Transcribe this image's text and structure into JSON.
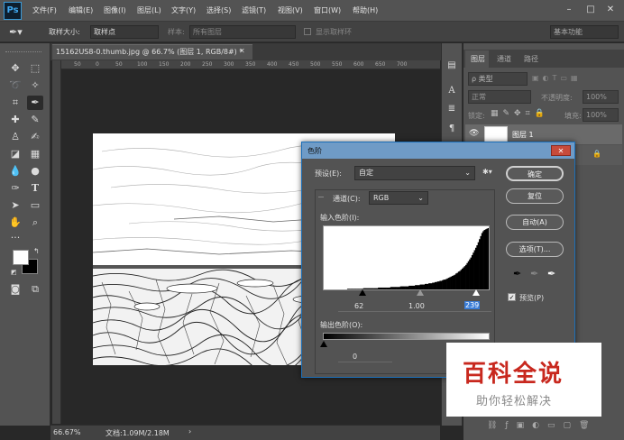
{
  "app": {
    "logo": "Ps"
  },
  "menu": [
    "文件(F)",
    "编辑(E)",
    "图像(I)",
    "图层(L)",
    "文字(Y)",
    "选择(S)",
    "滤镜(T)",
    "视图(V)",
    "窗口(W)",
    "帮助(H)"
  ],
  "window": {
    "minimize": "–",
    "maximize": "□",
    "close": "✕"
  },
  "options": {
    "sample_size_label": "取样大小:",
    "sample_size_value": "取样点",
    "sample_label": "样本:",
    "sample_value": "所有图层",
    "show_ring": "显示取样环",
    "workspace": "基本功能"
  },
  "document": {
    "tab": "15162US8-0.thumb.jpg @ 66.7% (图层 1, RGB/8#) *",
    "tab_close": "✕",
    "zoom": "66.67%",
    "doc_size": "文档:1.09M/2.18M"
  },
  "ruler": [
    "50",
    "0",
    "50",
    "100",
    "150",
    "200",
    "250",
    "300",
    "350",
    "400",
    "450",
    "500",
    "550",
    "600",
    "650",
    "700"
  ],
  "layers": {
    "tabs": [
      "图层",
      "通道",
      "路径"
    ],
    "search": "ρ 类型",
    "blend": "正常",
    "opacity_label": "不透明度:",
    "opacity": "100%",
    "lock_label": "锁定:",
    "fill_label": "填充:",
    "fill": "100%",
    "layer_name": "图层 1"
  },
  "dialog": {
    "title": "色阶",
    "preset_label": "预设(E):",
    "preset_value": "自定",
    "channel_label": "通道(C):",
    "channel_value": "RGB",
    "input_label": "输入色阶(I):",
    "input_black": "62",
    "input_gamma": "1.00",
    "input_white": "239",
    "output_label": "输出色阶(O):",
    "output_black": "0",
    "ok": "确定",
    "reset": "复位",
    "auto": "自动(A)",
    "options": "选项(T)...",
    "preview": "预览(P)"
  },
  "watermark": {
    "title": "百科全说",
    "subtitle": "助你轻松解决"
  },
  "histogram": {
    "bins": [
      0,
      0,
      0,
      0,
      0,
      0,
      0,
      0,
      0,
      0,
      0,
      0,
      0,
      0,
      0,
      0,
      0,
      0,
      0,
      1,
      1,
      1,
      1,
      1,
      1,
      1,
      1,
      1,
      1,
      1,
      1,
      1,
      2,
      2,
      2,
      2,
      2,
      2,
      2,
      2,
      2,
      2,
      2,
      2,
      3,
      3,
      3,
      3,
      3,
      3,
      3,
      3,
      3,
      3,
      4,
      4,
      4,
      4,
      4,
      4,
      4,
      4,
      5,
      5,
      5,
      5,
      5,
      5,
      5,
      6,
      6,
      6,
      6,
      6,
      7,
      7,
      7,
      7,
      8,
      8,
      8,
      8,
      9,
      9,
      9,
      10,
      10,
      10,
      11,
      11,
      12,
      12,
      13,
      13,
      14,
      14,
      15,
      16,
      16,
      17,
      18,
      19,
      20,
      21,
      22,
      23,
      24,
      26,
      27,
      29,
      30,
      32,
      34,
      36,
      38,
      40,
      43,
      46,
      49,
      52,
      56,
      60,
      64,
      68,
      72,
      77,
      82,
      87,
      92,
      95,
      97,
      98,
      99,
      100
    ]
  },
  "colors": {
    "accent": "#1c6fb8",
    "panel": "#535353",
    "dialog_title": "#6f9bc6",
    "watermark_red": "#c8281e"
  }
}
